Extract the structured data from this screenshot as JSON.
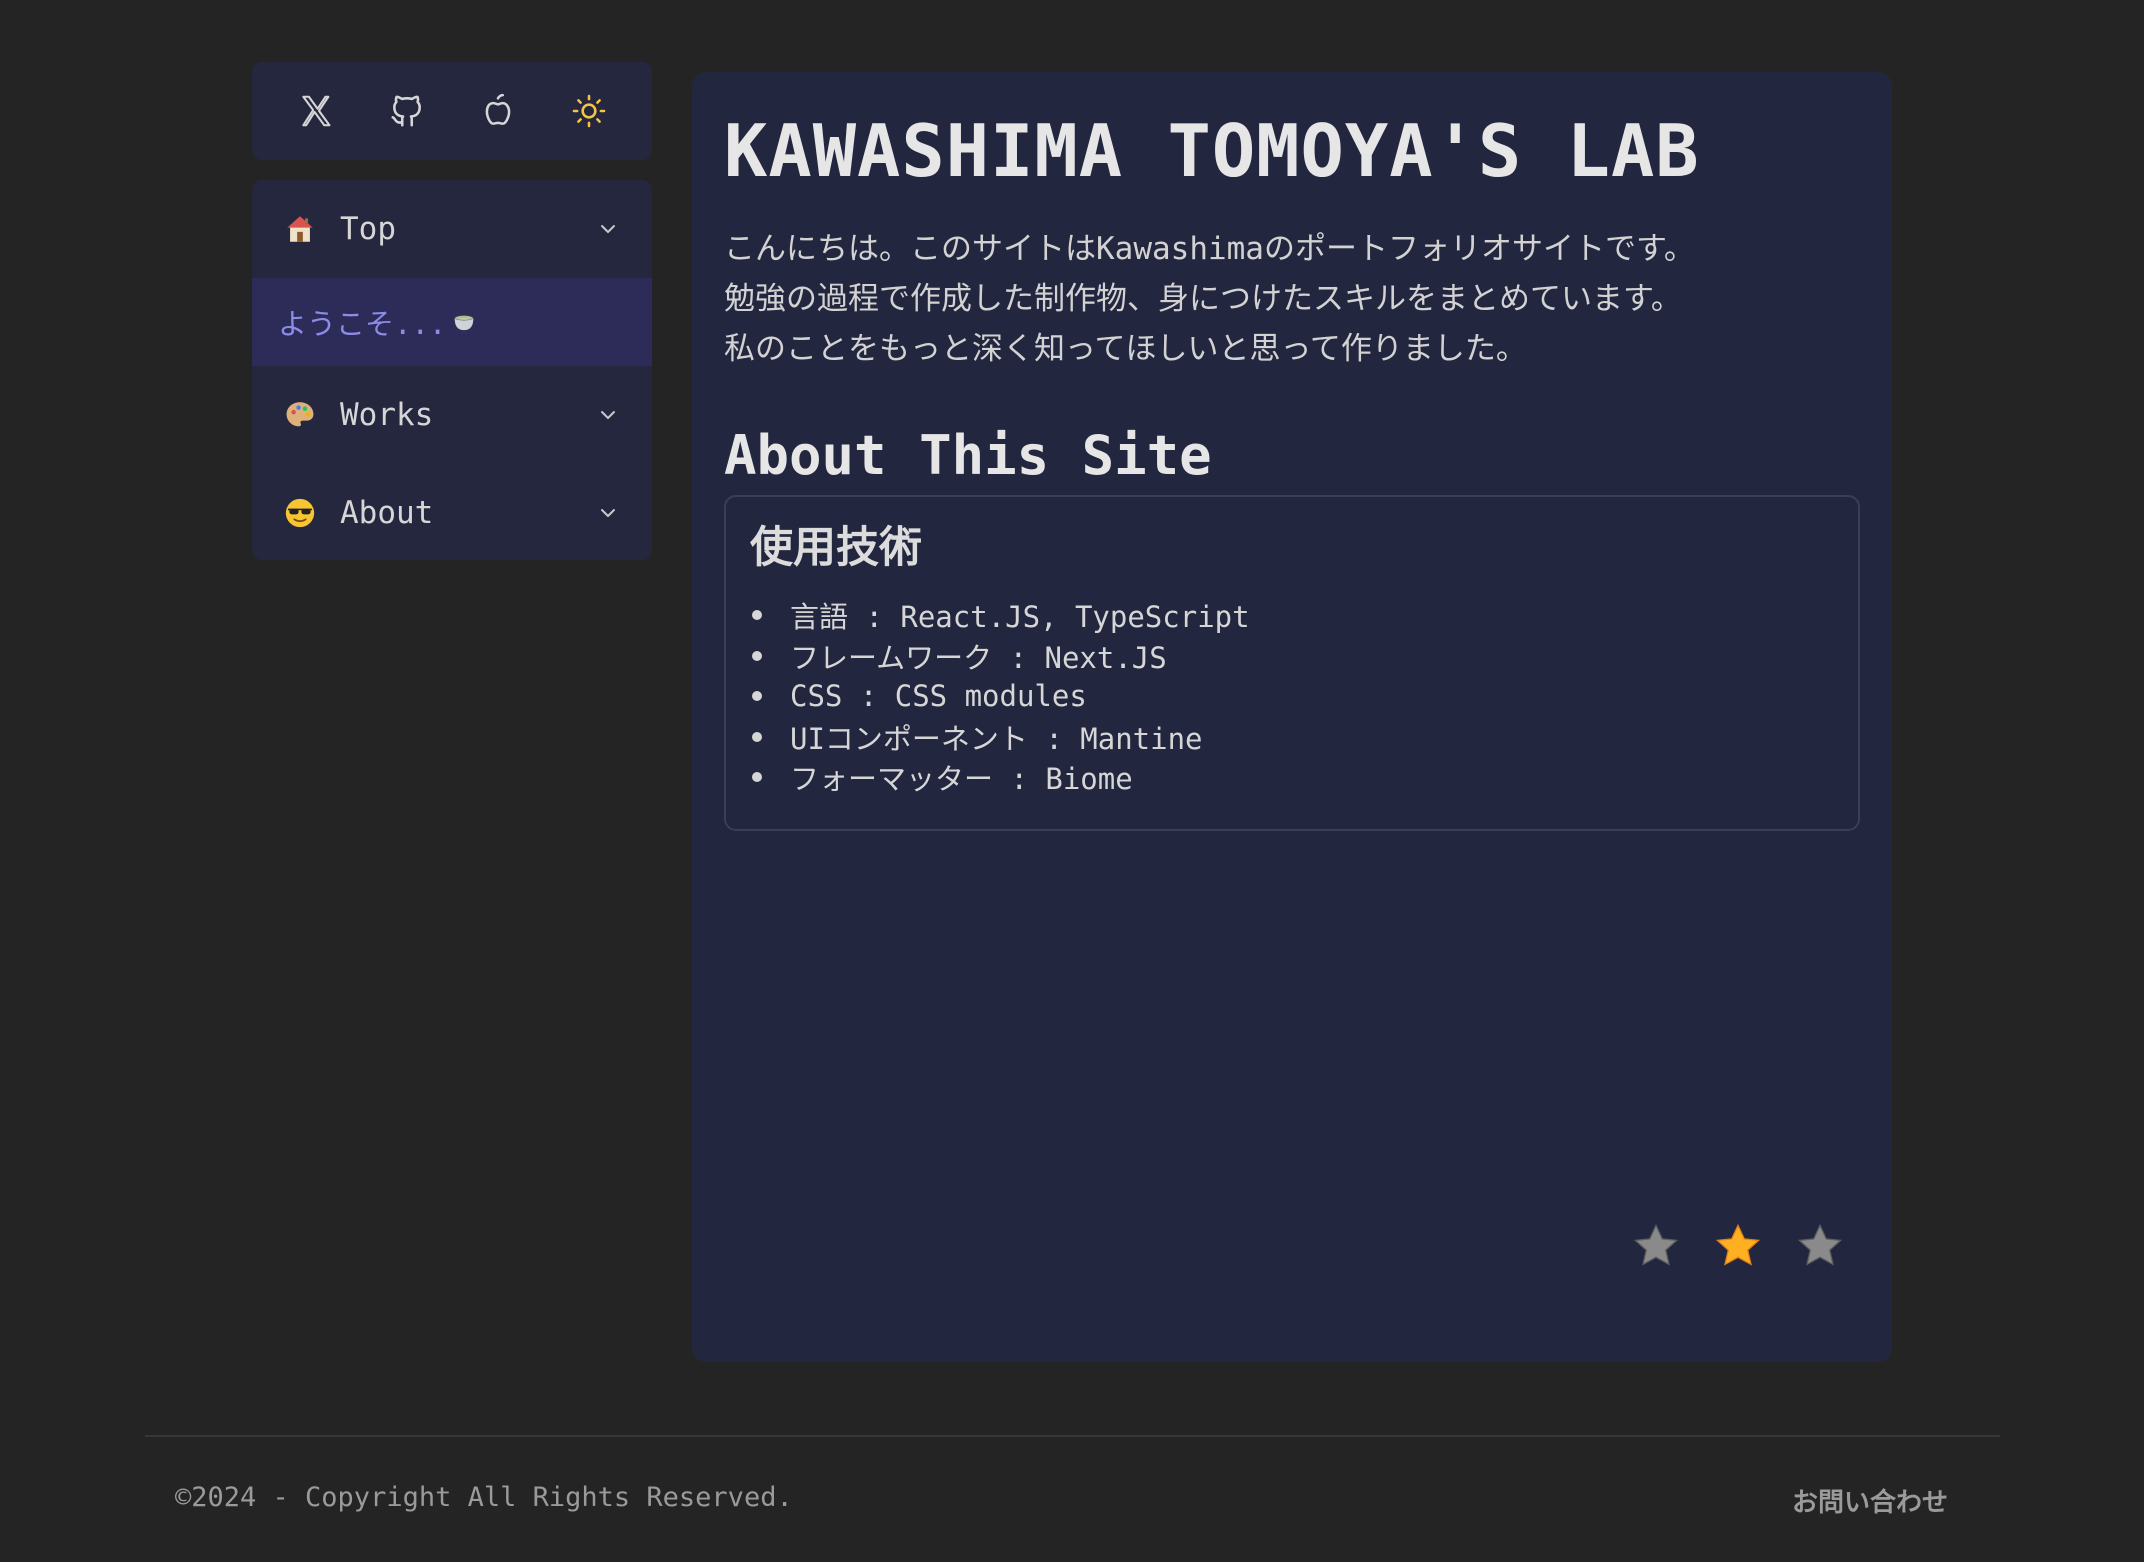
{
  "colors": {
    "page_bg": "#242424",
    "card_bg": "#23263f",
    "nav_active_bg": "#2d2b58",
    "nav_active_text": "#8b8ce8",
    "sun_icon": "#f5c542",
    "star_active": "#ffb020",
    "star_inactive": "#8a8a8a"
  },
  "social": {
    "icons": [
      "x-icon",
      "github-icon",
      "apple-icon",
      "sun-icon"
    ]
  },
  "nav": {
    "items": [
      {
        "icon": "house-icon",
        "label": "Top",
        "expanded": true
      },
      {
        "icon": "palette-icon",
        "label": "Works",
        "expanded": false
      },
      {
        "icon": "sunglasses-face-icon",
        "label": "About",
        "expanded": false
      }
    ],
    "top_sub": {
      "label": "ようこそ...",
      "icon": "teacup-icon"
    }
  },
  "main": {
    "title": "KAWASHIMA TOMOYA'S LAB",
    "intro": [
      "こんにちは。このサイトはKawashimaのポートフォリオサイトです。",
      "勉強の過程で作成した制作物、身につけたスキルをまとめています。",
      "私のことをもっと深く知ってほしいと思って作りました。"
    ],
    "section_title": "About This Site",
    "tech": {
      "title": "使用技術",
      "items": [
        "言語 : React.JS, TypeScript",
        "フレームワーク : Next.JS",
        "CSS : CSS modules",
        "UIコンポーネント : Mantine",
        "フォーマッター : Biome"
      ]
    },
    "stars": {
      "active_index": 1,
      "count": 3
    }
  },
  "footer": {
    "copyright": "©2024 - Copyright All Rights Reserved.",
    "contact": "お問い合わせ"
  }
}
